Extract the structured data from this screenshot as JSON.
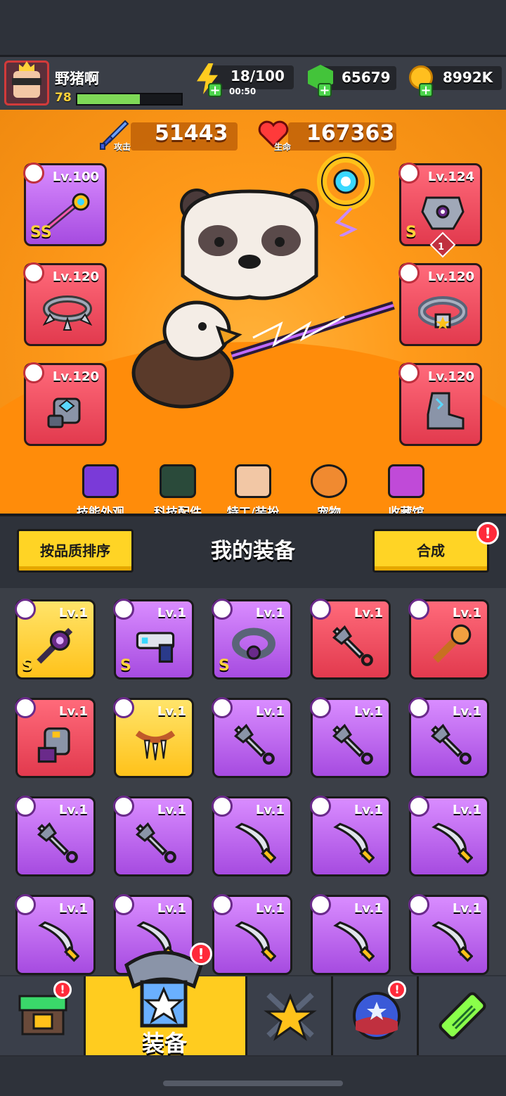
{
  "player": {
    "name": "野猪啊",
    "level": "78",
    "xp_fraction": 0.6
  },
  "resources": {
    "energy": "18/100",
    "energy_timer": "00:50",
    "gems": "65679",
    "coins": "8992K"
  },
  "stats": {
    "attack_label": "攻击",
    "attack_value": "51443",
    "hp_label": "生命",
    "hp_value": "167363"
  },
  "equipped": {
    "weapon": {
      "level": "Lv.100",
      "rank": "SS",
      "color": "purple",
      "icon": "staff-icon"
    },
    "armor": {
      "level": "Lv.124",
      "rank": "S",
      "color": "red",
      "icon": "armor-icon",
      "badge": "1"
    },
    "necklace": {
      "level": "Lv.120",
      "color": "red",
      "icon": "spiked-collar-icon"
    },
    "belt": {
      "level": "Lv.120",
      "color": "red",
      "icon": "belt-icon"
    },
    "gloves": {
      "level": "Lv.120",
      "color": "red",
      "icon": "glove-icon"
    },
    "boots": {
      "level": "Lv.120",
      "color": "red",
      "icon": "boot-icon"
    }
  },
  "categories": [
    {
      "label": "技能外观",
      "icon": "skin-icon"
    },
    {
      "label": "科技配件",
      "icon": "tech-icon"
    },
    {
      "label": "特工/装扮",
      "icon": "agent-icon"
    },
    {
      "label": "宠物",
      "icon": "pet-icon"
    },
    {
      "label": "收藏馆",
      "icon": "collection-icon"
    }
  ],
  "toolbar": {
    "sort_label": "按品质排序",
    "title": "我的装备",
    "merge_label": "合成",
    "merge_badge": "!"
  },
  "inventory": [
    {
      "level": "Lv.1",
      "color": "yellow",
      "rank": "S",
      "icon": "staff-icon"
    },
    {
      "level": "Lv.1",
      "color": "purple",
      "rank": "S",
      "icon": "gun-icon"
    },
    {
      "level": "Lv.1",
      "color": "purple",
      "rank": "S",
      "icon": "collar-icon"
    },
    {
      "level": "Lv.1",
      "color": "red",
      "rank": "",
      "icon": "kunai-icon"
    },
    {
      "level": "Lv.1",
      "color": "red",
      "rank": "",
      "icon": "bat-icon"
    },
    {
      "level": "Lv.1",
      "color": "red",
      "rank": "",
      "icon": "glove-icon"
    },
    {
      "level": "Lv.1",
      "color": "yellow",
      "rank": "",
      "icon": "fang-necklace-icon"
    },
    {
      "level": "Lv.1",
      "color": "purple",
      "rank": "",
      "icon": "kunai-icon"
    },
    {
      "level": "Lv.1",
      "color": "purple",
      "rank": "",
      "icon": "kunai-icon"
    },
    {
      "level": "Lv.1",
      "color": "purple",
      "rank": "",
      "icon": "kunai-icon"
    },
    {
      "level": "Lv.1",
      "color": "purple",
      "rank": "",
      "icon": "kunai-icon"
    },
    {
      "level": "Lv.1",
      "color": "purple",
      "rank": "",
      "icon": "kunai-icon"
    },
    {
      "level": "Lv.1",
      "color": "purple",
      "rank": "",
      "icon": "sword-icon"
    },
    {
      "level": "Lv.1",
      "color": "purple",
      "rank": "",
      "icon": "sword-icon"
    },
    {
      "level": "Lv.1",
      "color": "purple",
      "rank": "",
      "icon": "sword-icon"
    },
    {
      "level": "Lv.1",
      "color": "purple",
      "rank": "",
      "icon": "sword-icon"
    },
    {
      "level": "Lv.1",
      "color": "purple",
      "rank": "",
      "icon": "sword-icon"
    },
    {
      "level": "Lv.1",
      "color": "purple",
      "rank": "",
      "icon": "sword-icon"
    },
    {
      "level": "Lv.1",
      "color": "purple",
      "rank": "",
      "icon": "sword-icon"
    },
    {
      "level": "Lv.1",
      "color": "purple",
      "rank": "",
      "icon": "sword-icon"
    }
  ],
  "nav": {
    "items": [
      {
        "icon": "shop-icon",
        "badge": "!"
      },
      {
        "label": "装备",
        "icon": "equipment-icon",
        "badge": "!"
      },
      {
        "icon": "star-swords-icon"
      },
      {
        "icon": "stars-planet-icon",
        "badge": "!"
      },
      {
        "icon": "dna-tube-icon"
      }
    ]
  },
  "colors": {
    "red": "#e23a4e",
    "purple": "#a64be0",
    "yellow": "#ffc21a",
    "accent": "#ffcc1f"
  }
}
